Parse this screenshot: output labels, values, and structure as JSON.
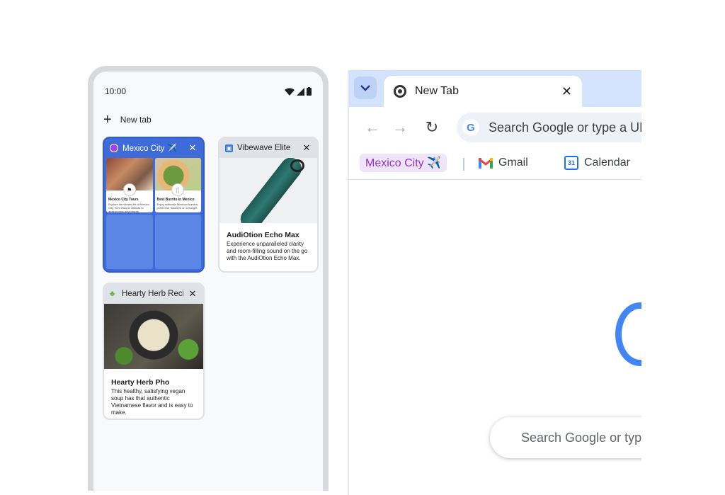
{
  "phone": {
    "time": "10:00",
    "new_tab_label": "New tab",
    "tabs": [
      {
        "title": "Mexico City ✈️",
        "type": "group",
        "color": "#3f6bd8",
        "pages": [
          {
            "title": "Mexico City Tours",
            "desc": "Explore the vibrant life of Mexico City, from historic districts to gastronomic adventures."
          },
          {
            "title": "Best Burrito in Mexico",
            "desc": "Enjoy authentic Mexican burritos, perfect for travelers on a budget."
          }
        ]
      },
      {
        "title": "Vibewave Elite",
        "product_title": "AudiOtion Echo Max",
        "desc": "Experience unparalleled clarity and room-filling sound on the go with the AudiOtion Echo Max."
      },
      {
        "title": "Hearty Herb Recipe",
        "product_title": "Hearty Herb Pho",
        "desc": "This healthy, satisfying vegan soup has that authentic Vietnamese flavor and is easy to make."
      }
    ]
  },
  "browser": {
    "active_tab_title": "New Tab",
    "omnibox_placeholder": "Search Google or type a URL",
    "bookmarks": [
      "Mexico City ✈️",
      "Gmail",
      "Calendar"
    ],
    "calendar_day": "31",
    "ntp_search_placeholder": "Search Google or type a URL",
    "accent_color": "#4285f4"
  }
}
